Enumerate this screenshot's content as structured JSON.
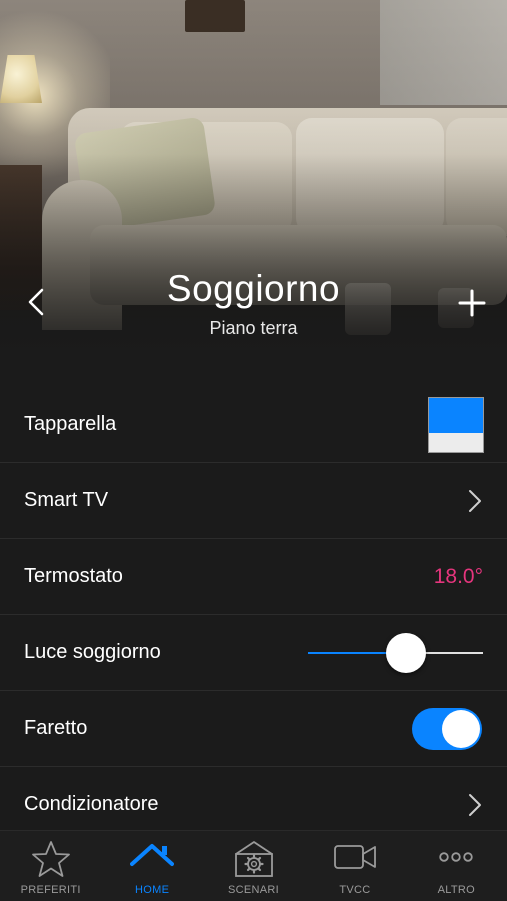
{
  "header": {
    "title": "Soggiorno",
    "subtitle": "Piano terra",
    "back_icon": "chevron-left-icon",
    "add_icon": "plus-icon"
  },
  "devices": [
    {
      "label": "Tapparella",
      "control": "blind",
      "open_fraction": 0.65
    },
    {
      "label": "Smart TV",
      "control": "chevron"
    },
    {
      "label": "Termostato",
      "control": "value",
      "value": "18.0°"
    },
    {
      "label": "Luce soggiorno",
      "control": "slider",
      "level": 0.56
    },
    {
      "label": "Faretto",
      "control": "toggle",
      "on": true
    },
    {
      "label": "Condizionatore",
      "control": "chevron"
    }
  ],
  "tabs": [
    {
      "label": "PREFERITI",
      "icon": "star-icon",
      "active": false
    },
    {
      "label": "HOME",
      "icon": "home-icon",
      "active": true
    },
    {
      "label": "SCENARI",
      "icon": "gear-house-icon",
      "active": false
    },
    {
      "label": "TVCC",
      "icon": "video-camera-icon",
      "active": false
    },
    {
      "label": "ALTRO",
      "icon": "more-dots-icon",
      "active": false
    }
  ],
  "colors": {
    "accent": "#0a84ff",
    "temperature": "#e5357d",
    "background": "#1b1b1b"
  }
}
